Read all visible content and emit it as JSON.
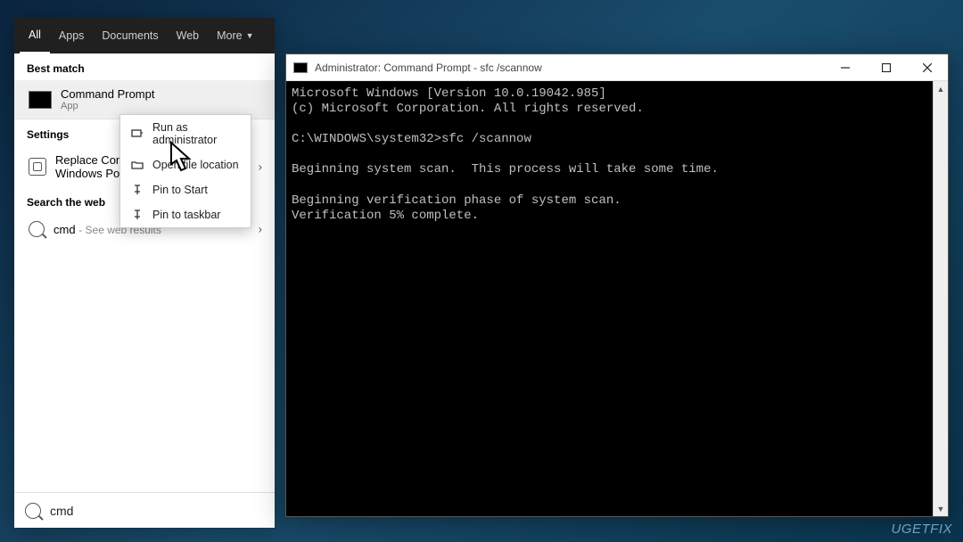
{
  "search": {
    "tabs": {
      "all": "All",
      "apps": "Apps",
      "documents": "Documents",
      "web": "Web",
      "more": "More"
    },
    "section_best": "Best match",
    "best_match": {
      "title": "Command Prompt",
      "subtitle": "App"
    },
    "section_settings": "Settings",
    "settings_item": "Replace Command Prompt with Windows PowerShell",
    "settings_item_short1": "Replace Command Prompt with",
    "settings_item_short2": "Windows PowerShell",
    "section_web": "Search the web",
    "web_item_prefix": "cmd",
    "web_item_suffix": " - See web results",
    "input_value": "cmd"
  },
  "context_menu": {
    "run_admin": "Run as administrator",
    "open_location": "Open file location",
    "pin_start": "Pin to Start",
    "pin_taskbar": "Pin to taskbar"
  },
  "cmd_window": {
    "title": "Administrator: Command Prompt - sfc  /scannow",
    "lines": {
      "l1": "Microsoft Windows [Version 10.0.19042.985]",
      "l2": "(c) Microsoft Corporation. All rights reserved.",
      "l3": "",
      "l4": "C:\\WINDOWS\\system32>sfc /scannow",
      "l5": "",
      "l6": "Beginning system scan.  This process will take some time.",
      "l7": "",
      "l8": "Beginning verification phase of system scan.",
      "l9": "Verification 5% complete."
    }
  },
  "watermark": "UGETFIX"
}
